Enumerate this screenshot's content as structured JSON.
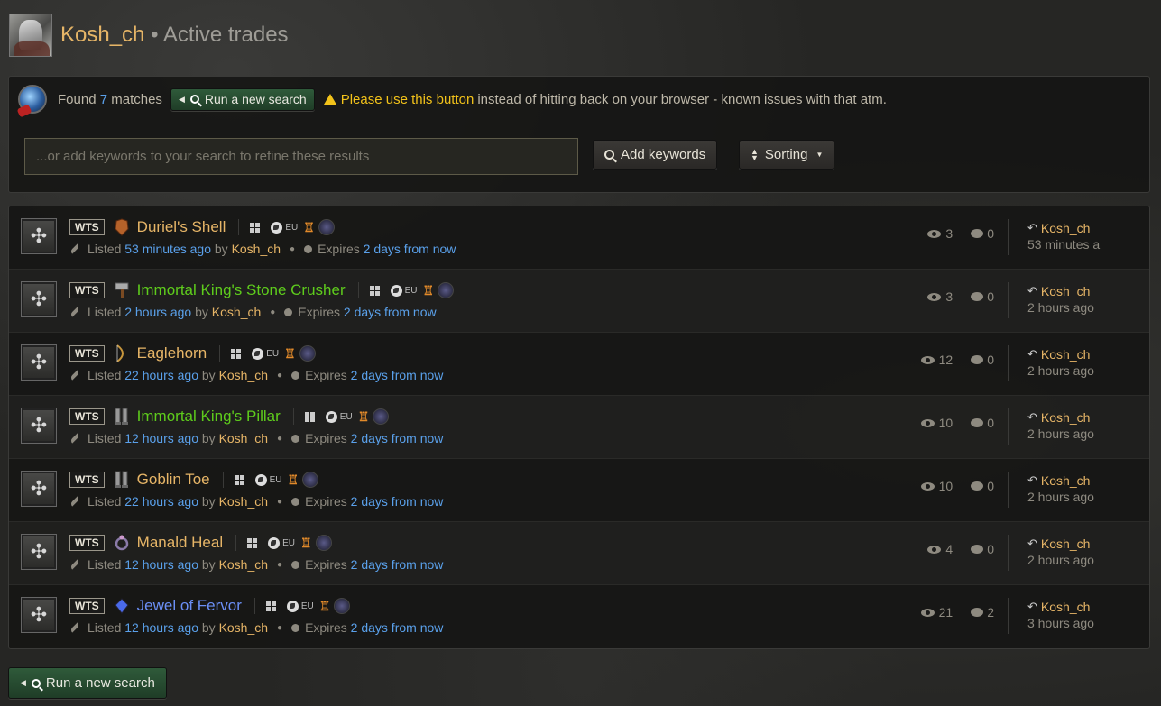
{
  "header": {
    "user": "Kosh_ch",
    "separator": "•",
    "subtitle": "Active trades"
  },
  "search": {
    "found_prefix": "Found",
    "found_count": "7",
    "found_suffix": "matches",
    "run_new_search_label": "Run a new search",
    "warning_highlight": "Please use this button",
    "warning_rest": "instead of hitting back on your browser - known issues with that atm.",
    "keywords_placeholder": "...or add keywords to your search to refine these results",
    "add_keywords_label": "Add keywords",
    "sorting_label": "Sorting"
  },
  "colors": {
    "legendary": "#e6b567",
    "set": "#5ecc1c",
    "magic": "#6b8ff5",
    "link": "#5aa0ea"
  },
  "meta_labels": {
    "listed": "Listed",
    "by": "by",
    "expires": "Expires",
    "region": "EU",
    "wts": "WTS"
  },
  "trades": [
    {
      "name": "Duriel's Shell",
      "quality": "legendary",
      "icon": "chest-armor-icon",
      "listed": "53 minutes ago",
      "seller": "Kosh_ch",
      "expires": "2 days from now",
      "views": "3",
      "comments": "0",
      "seller_time": "53 minutes a"
    },
    {
      "name": "Immortal King's Stone Crusher",
      "quality": "set",
      "icon": "maul-icon",
      "listed": "2 hours ago",
      "seller": "Kosh_ch",
      "expires": "2 days from now",
      "views": "3",
      "comments": "0",
      "seller_time": "2 hours ago"
    },
    {
      "name": "Eaglehorn",
      "quality": "legendary",
      "icon": "bow-icon",
      "listed": "22 hours ago",
      "seller": "Kosh_ch",
      "expires": "2 days from now",
      "views": "12",
      "comments": "0",
      "seller_time": "2 hours ago"
    },
    {
      "name": "Immortal King's Pillar",
      "quality": "set",
      "icon": "boots-icon",
      "listed": "12 hours ago",
      "seller": "Kosh_ch",
      "expires": "2 days from now",
      "views": "10",
      "comments": "0",
      "seller_time": "2 hours ago"
    },
    {
      "name": "Goblin Toe",
      "quality": "legendary",
      "icon": "boots-icon",
      "listed": "22 hours ago",
      "seller": "Kosh_ch",
      "expires": "2 days from now",
      "views": "10",
      "comments": "0",
      "seller_time": "2 hours ago"
    },
    {
      "name": "Manald Heal",
      "quality": "legendary",
      "icon": "ring-icon",
      "listed": "12 hours ago",
      "seller": "Kosh_ch",
      "expires": "2 days from now",
      "views": "4",
      "comments": "0",
      "seller_time": "2 hours ago"
    },
    {
      "name": "Jewel of Fervor",
      "quality": "magic",
      "icon": "jewel-icon",
      "listed": "12 hours ago",
      "seller": "Kosh_ch",
      "expires": "2 days from now",
      "views": "21",
      "comments": "2",
      "seller_time": "3 hours ago"
    }
  ],
  "bottom": {
    "run_new_search_label": "Run a new search"
  }
}
